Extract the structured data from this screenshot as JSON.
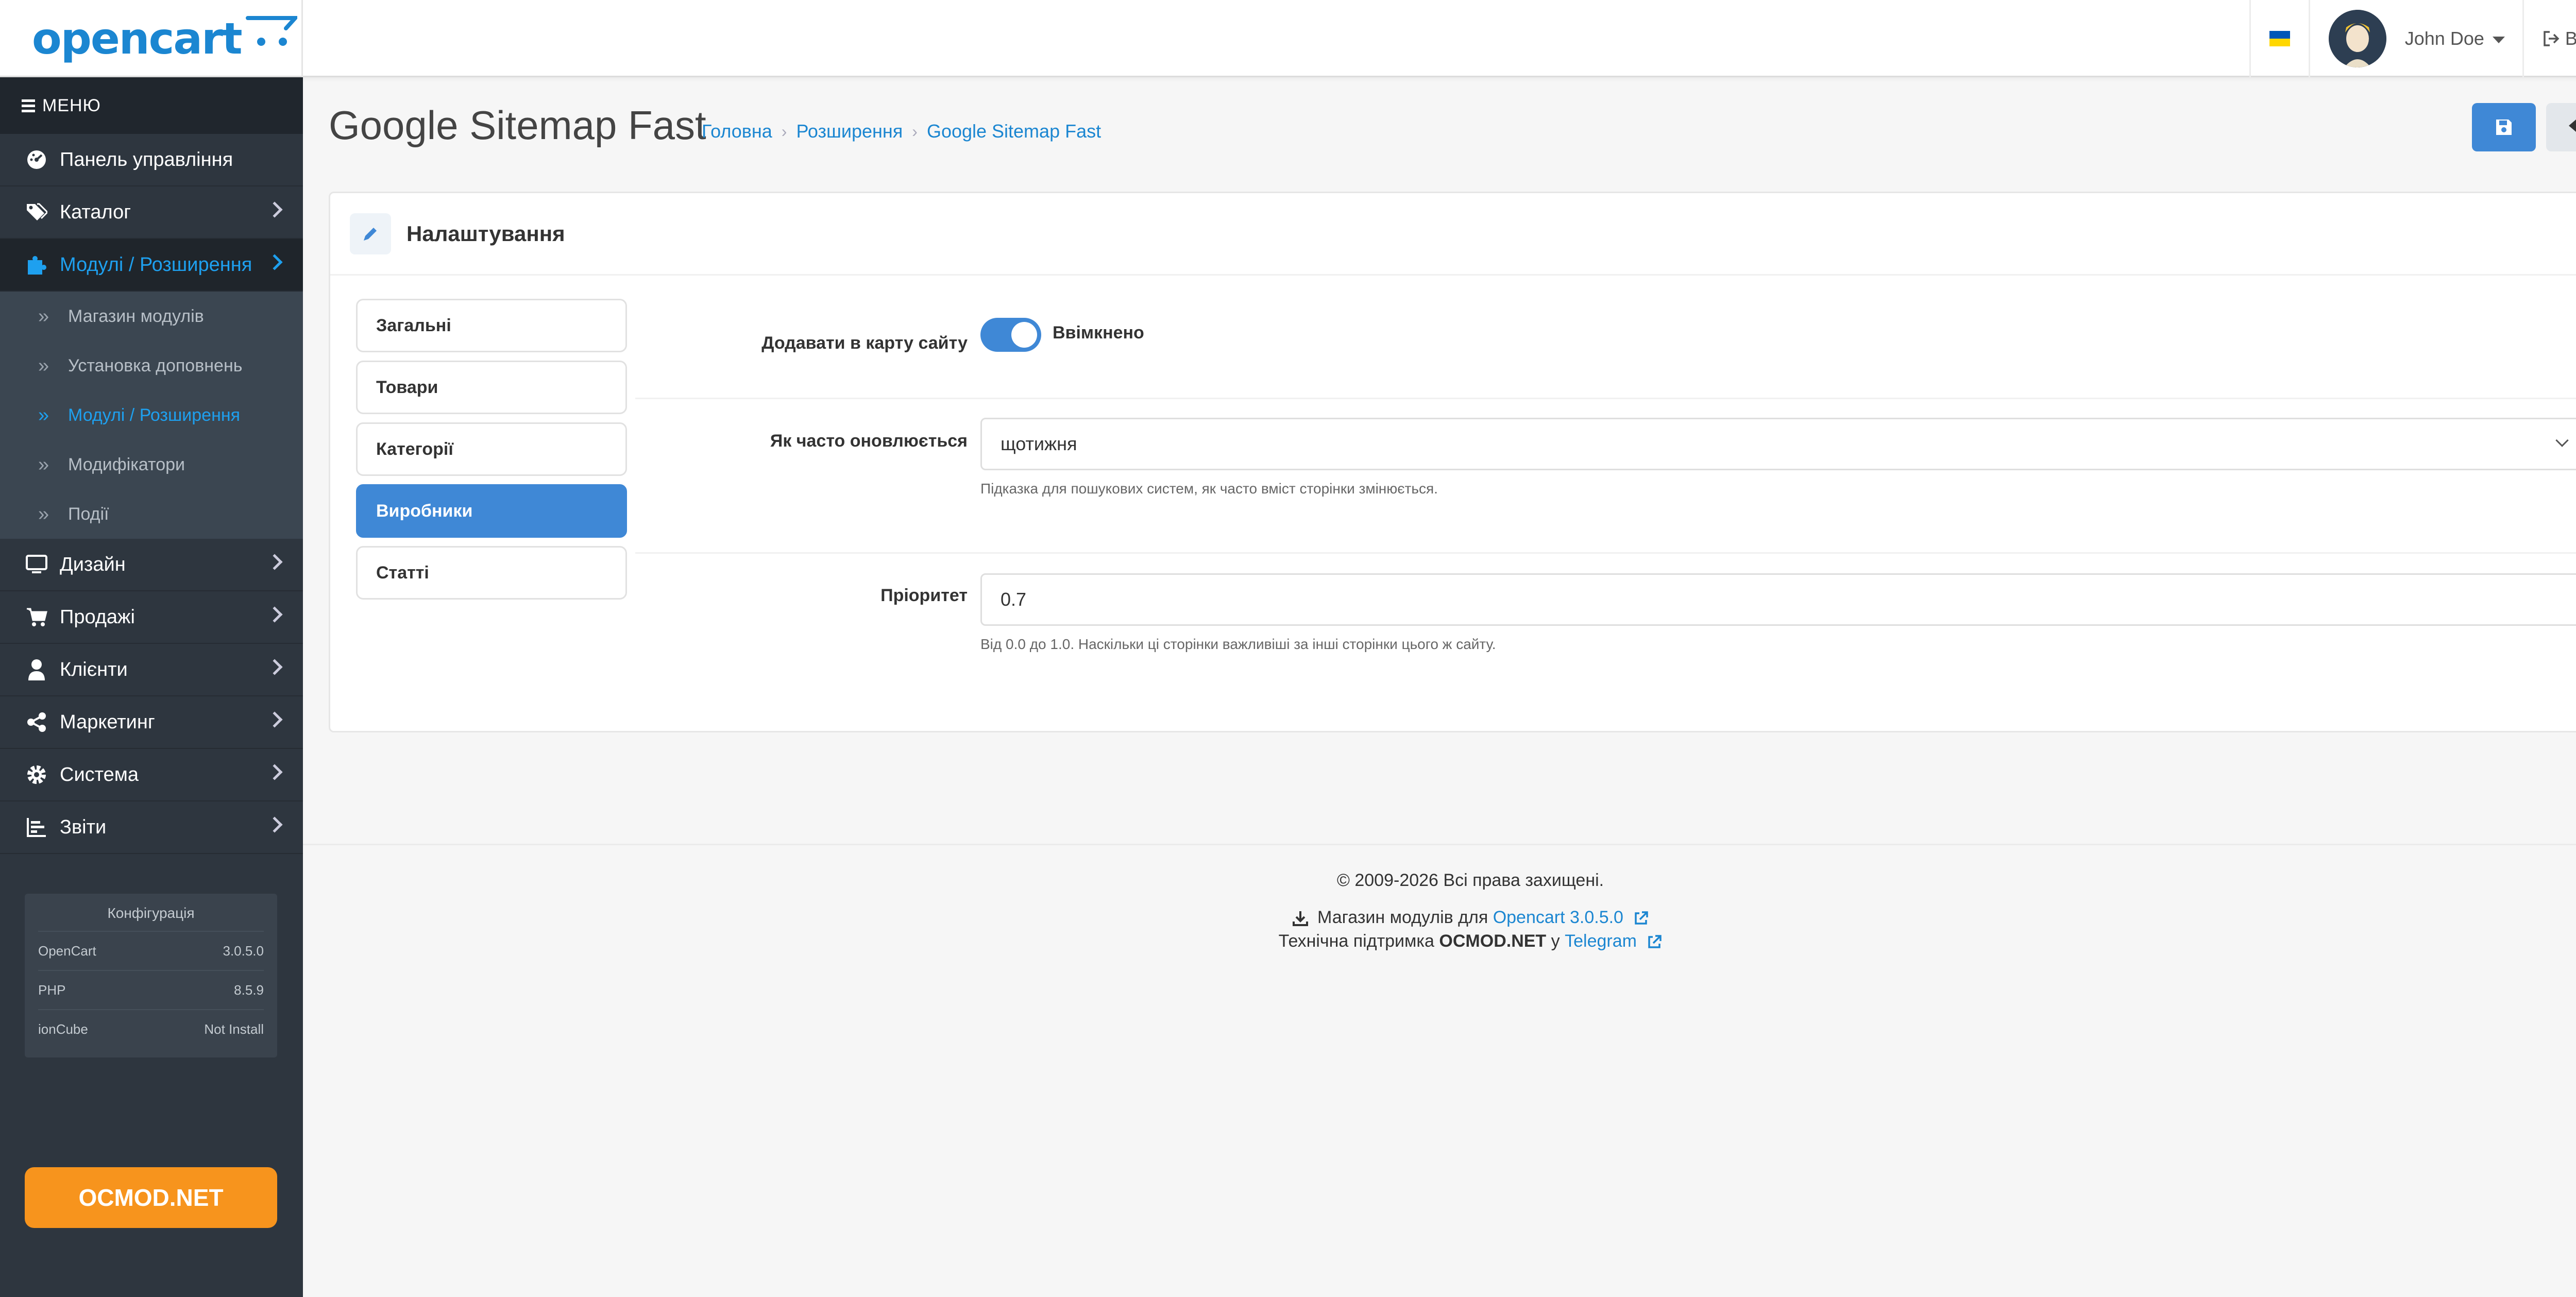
{
  "header": {
    "logo_text": "opencart",
    "user_name": "John Doe",
    "logout_label": "Вихід",
    "flag_colors": [
      "#0057b7",
      "#ffd700"
    ]
  },
  "sidebar": {
    "menu_label": "МЕНЮ",
    "items": [
      {
        "label": "Панель управління",
        "icon": "dashboard-icon"
      },
      {
        "label": "Каталог",
        "icon": "tags-icon"
      },
      {
        "label": "Модулі / Розширення",
        "icon": "puzzle-icon",
        "active": true
      },
      {
        "label": "Дизайн",
        "icon": "monitor-icon"
      },
      {
        "label": "Продажі",
        "icon": "cart-icon"
      },
      {
        "label": "Клієнти",
        "icon": "user-icon"
      },
      {
        "label": "Маркетинг",
        "icon": "share-icon"
      },
      {
        "label": "Система",
        "icon": "gear-icon"
      },
      {
        "label": "Звіти",
        "icon": "chart-icon"
      }
    ],
    "subitems": [
      {
        "label": "Магазин модулів"
      },
      {
        "label": "Установка доповнень"
      },
      {
        "label": "Модулі / Розширення",
        "active": true
      },
      {
        "label": "Модифікатори"
      },
      {
        "label": "Події"
      }
    ],
    "config": {
      "title": "Конфігурація",
      "rows": [
        {
          "key": "OpenCart",
          "value": "3.0.5.0"
        },
        {
          "key": "PHP",
          "value": "8.5.9"
        },
        {
          "key": "ionCube",
          "value": "Not Install"
        }
      ]
    },
    "ocmod_button": "OCMOD.NET"
  },
  "page": {
    "title": "Google Sitemap Fast",
    "breadcrumb": [
      "Головна",
      "Розширення",
      "Google Sitemap Fast"
    ]
  },
  "card": {
    "title": "Налаштування",
    "tabs": [
      "Загальні",
      "Товари",
      "Категорії",
      "Виробники",
      "Статті"
    ],
    "active_tab": "Виробники",
    "fields": {
      "add_label": "Додавати в карту сайту",
      "add_state": "Ввімкнено",
      "freq_label": "Як часто оновлюється",
      "freq_value": "щотижня",
      "freq_help": "Підказка для пошукових систем, як часто вміст сторінки змінюється.",
      "priority_label": "Пріоритет",
      "priority_value": "0.7",
      "priority_help": "Від 0.0 до 1.0. Наскільки ці сторінки важливіші за інші сторінки цього ж сайту."
    }
  },
  "footer": {
    "copyright": "© 2009-2026 Всі права захищені.",
    "store_prefix": "Магазин модулів для",
    "store_link": "Opencart 3.0.5.0",
    "support_prefix": "Технічна підтримка",
    "support_brand": "OCMOD.NET",
    "support_mid": "у",
    "support_link": "Telegram"
  },
  "colors": {
    "accent": "#3f88d6",
    "link": "#1b86d1",
    "sidebar_bg": "#2e363f",
    "ocmod_orange": "#f7941d"
  }
}
